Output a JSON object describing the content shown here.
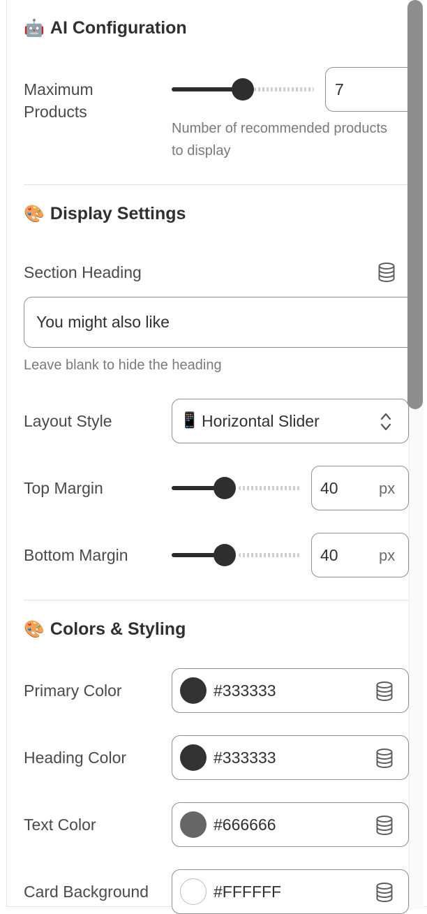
{
  "ai_config": {
    "icon": "robot-emoji",
    "emoji": "🤖",
    "title": "AI Configuration",
    "max_products": {
      "label": "Maximum Products",
      "value": "7",
      "slider_fraction": 0.5,
      "help": "Number of recommended products to display"
    }
  },
  "display": {
    "icon": "palette-emoji",
    "emoji": "🎨",
    "title": "Display Settings",
    "section_heading": {
      "label": "Section Heading",
      "value": "You might also like",
      "help": "Leave blank to hide the heading"
    },
    "layout_style": {
      "label": "Layout Style",
      "emoji": "📱",
      "value": "Horizontal Slider"
    },
    "top_margin": {
      "label": "Top Margin",
      "value": "40",
      "unit": "px",
      "slider_fraction": 0.4
    },
    "bottom_margin": {
      "label": "Bottom Margin",
      "value": "40",
      "unit": "px",
      "slider_fraction": 0.4
    }
  },
  "colors": {
    "icon": "palette-emoji",
    "emoji": "🎨",
    "title": "Colors & Styling",
    "fields": [
      {
        "label": "Primary Color",
        "value": "#333333",
        "swatch": "#333333"
      },
      {
        "label": "Heading Color",
        "value": "#333333",
        "swatch": "#333333"
      },
      {
        "label": "Text Color",
        "value": "#666666",
        "swatch": "#666666"
      },
      {
        "label": "Card Background",
        "value": "#FFFFFF",
        "swatch": "#FFFFFF"
      }
    ]
  }
}
